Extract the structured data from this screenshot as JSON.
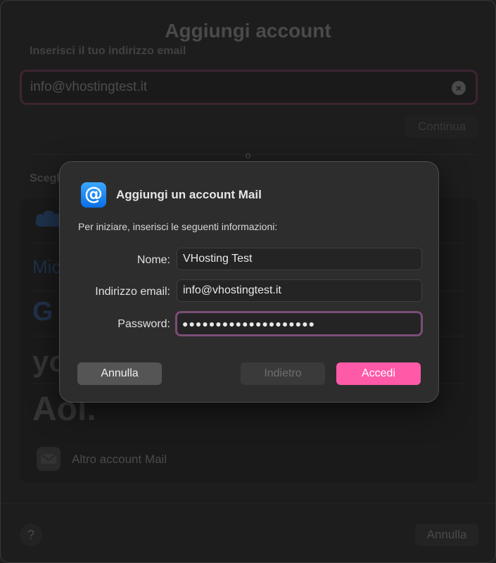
{
  "window": {
    "title": "Aggiungi account",
    "email_label": "Inserisci il tuo indirizzo email",
    "email_value": "info@vhostingtest.it",
    "clear_icon": "×",
    "continue_label": "Continua",
    "or_label": "o",
    "choose_label": "Scegl",
    "providers": {
      "microsoft": "Mic",
      "google": "G",
      "yahoo": "yo",
      "aol": "Aol."
    },
    "other_account_label": "Altro account Mail",
    "help_label": "?",
    "cancel_label": "Annulla"
  },
  "dialog": {
    "icon": "@",
    "title": "Aggiungi un account Mail",
    "subtitle": "Per iniziare, inserisci le seguenti informazioni:",
    "fields": {
      "name_label": "Nome:",
      "name_value": "VHosting Test",
      "email_label": "Indirizzo email:",
      "email_value": "info@vhostingtest.it",
      "password_label": "Password:",
      "password_value": "●●●●●●●●●●●●●●●●●●●●"
    },
    "buttons": {
      "cancel": "Annulla",
      "back": "Indietro",
      "login": "Accedi"
    }
  },
  "colors": {
    "accent": "#ff5aa8",
    "focus_ring": "#7a4d75",
    "mail_icon": "#1a8cff"
  }
}
